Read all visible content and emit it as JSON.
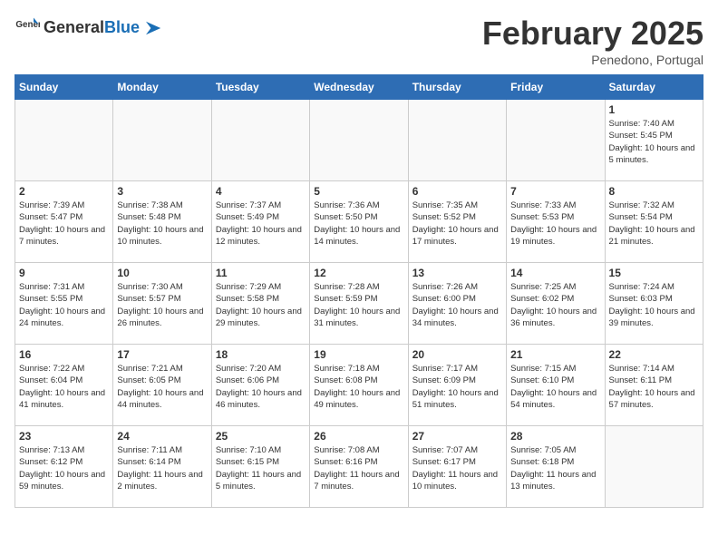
{
  "app": {
    "name_general": "General",
    "name_blue": "Blue"
  },
  "calendar": {
    "title": "February 2025",
    "subtitle": "Penedono, Portugal"
  },
  "headers": [
    "Sunday",
    "Monday",
    "Tuesday",
    "Wednesday",
    "Thursday",
    "Friday",
    "Saturday"
  ],
  "weeks": [
    [
      {
        "day": "",
        "info": ""
      },
      {
        "day": "",
        "info": ""
      },
      {
        "day": "",
        "info": ""
      },
      {
        "day": "",
        "info": ""
      },
      {
        "day": "",
        "info": ""
      },
      {
        "day": "",
        "info": ""
      },
      {
        "day": "1",
        "info": "Sunrise: 7:40 AM\nSunset: 5:45 PM\nDaylight: 10 hours and 5 minutes."
      }
    ],
    [
      {
        "day": "2",
        "info": "Sunrise: 7:39 AM\nSunset: 5:47 PM\nDaylight: 10 hours and 7 minutes."
      },
      {
        "day": "3",
        "info": "Sunrise: 7:38 AM\nSunset: 5:48 PM\nDaylight: 10 hours and 10 minutes."
      },
      {
        "day": "4",
        "info": "Sunrise: 7:37 AM\nSunset: 5:49 PM\nDaylight: 10 hours and 12 minutes."
      },
      {
        "day": "5",
        "info": "Sunrise: 7:36 AM\nSunset: 5:50 PM\nDaylight: 10 hours and 14 minutes."
      },
      {
        "day": "6",
        "info": "Sunrise: 7:35 AM\nSunset: 5:52 PM\nDaylight: 10 hours and 17 minutes."
      },
      {
        "day": "7",
        "info": "Sunrise: 7:33 AM\nSunset: 5:53 PM\nDaylight: 10 hours and 19 minutes."
      },
      {
        "day": "8",
        "info": "Sunrise: 7:32 AM\nSunset: 5:54 PM\nDaylight: 10 hours and 21 minutes."
      }
    ],
    [
      {
        "day": "9",
        "info": "Sunrise: 7:31 AM\nSunset: 5:55 PM\nDaylight: 10 hours and 24 minutes."
      },
      {
        "day": "10",
        "info": "Sunrise: 7:30 AM\nSunset: 5:57 PM\nDaylight: 10 hours and 26 minutes."
      },
      {
        "day": "11",
        "info": "Sunrise: 7:29 AM\nSunset: 5:58 PM\nDaylight: 10 hours and 29 minutes."
      },
      {
        "day": "12",
        "info": "Sunrise: 7:28 AM\nSunset: 5:59 PM\nDaylight: 10 hours and 31 minutes."
      },
      {
        "day": "13",
        "info": "Sunrise: 7:26 AM\nSunset: 6:00 PM\nDaylight: 10 hours and 34 minutes."
      },
      {
        "day": "14",
        "info": "Sunrise: 7:25 AM\nSunset: 6:02 PM\nDaylight: 10 hours and 36 minutes."
      },
      {
        "day": "15",
        "info": "Sunrise: 7:24 AM\nSunset: 6:03 PM\nDaylight: 10 hours and 39 minutes."
      }
    ],
    [
      {
        "day": "16",
        "info": "Sunrise: 7:22 AM\nSunset: 6:04 PM\nDaylight: 10 hours and 41 minutes."
      },
      {
        "day": "17",
        "info": "Sunrise: 7:21 AM\nSunset: 6:05 PM\nDaylight: 10 hours and 44 minutes."
      },
      {
        "day": "18",
        "info": "Sunrise: 7:20 AM\nSunset: 6:06 PM\nDaylight: 10 hours and 46 minutes."
      },
      {
        "day": "19",
        "info": "Sunrise: 7:18 AM\nSunset: 6:08 PM\nDaylight: 10 hours and 49 minutes."
      },
      {
        "day": "20",
        "info": "Sunrise: 7:17 AM\nSunset: 6:09 PM\nDaylight: 10 hours and 51 minutes."
      },
      {
        "day": "21",
        "info": "Sunrise: 7:15 AM\nSunset: 6:10 PM\nDaylight: 10 hours and 54 minutes."
      },
      {
        "day": "22",
        "info": "Sunrise: 7:14 AM\nSunset: 6:11 PM\nDaylight: 10 hours and 57 minutes."
      }
    ],
    [
      {
        "day": "23",
        "info": "Sunrise: 7:13 AM\nSunset: 6:12 PM\nDaylight: 10 hours and 59 minutes."
      },
      {
        "day": "24",
        "info": "Sunrise: 7:11 AM\nSunset: 6:14 PM\nDaylight: 11 hours and 2 minutes."
      },
      {
        "day": "25",
        "info": "Sunrise: 7:10 AM\nSunset: 6:15 PM\nDaylight: 11 hours and 5 minutes."
      },
      {
        "day": "26",
        "info": "Sunrise: 7:08 AM\nSunset: 6:16 PM\nDaylight: 11 hours and 7 minutes."
      },
      {
        "day": "27",
        "info": "Sunrise: 7:07 AM\nSunset: 6:17 PM\nDaylight: 11 hours and 10 minutes."
      },
      {
        "day": "28",
        "info": "Sunrise: 7:05 AM\nSunset: 6:18 PM\nDaylight: 11 hours and 13 minutes."
      },
      {
        "day": "",
        "info": ""
      }
    ]
  ]
}
